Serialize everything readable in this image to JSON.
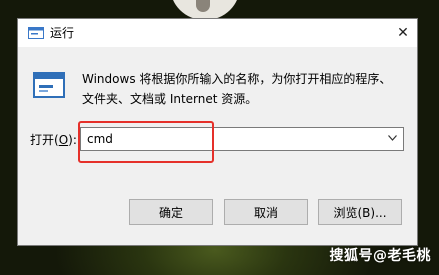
{
  "window": {
    "title": "运行",
    "title_icon": "run-dialog-icon",
    "close_glyph": "✕"
  },
  "main": {
    "icon": "run-program-icon",
    "description_line1": "Windows 将根据你所输入的名称，为你打开相应的程序、",
    "description_line2": "文件夹、文档或 Internet 资源。",
    "open_label": "打开(",
    "open_label_key": "O",
    "open_label_end": "):",
    "input_value": "cmd"
  },
  "buttons": {
    "ok": "确定",
    "cancel": "取消",
    "browse": "浏览(B)..."
  },
  "annotation": {
    "highlight_color": "#e5302a"
  },
  "watermark": "搜狐号@老毛桃"
}
